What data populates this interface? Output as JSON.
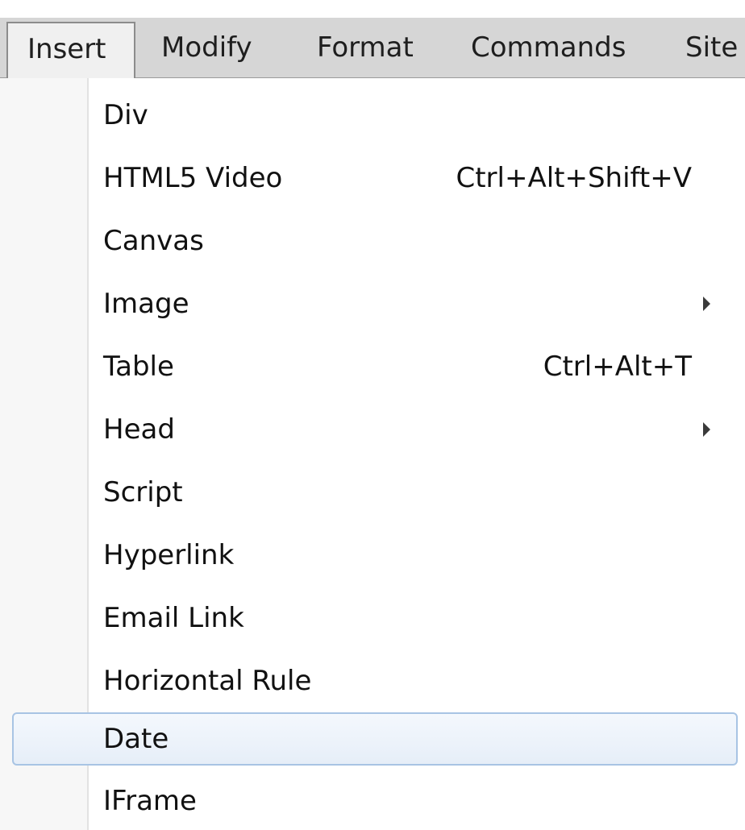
{
  "menubar": {
    "items": [
      {
        "label": "Insert",
        "active": true
      },
      {
        "label": "Modify",
        "active": false
      },
      {
        "label": "Format",
        "active": false
      },
      {
        "label": "Commands",
        "active": false
      },
      {
        "label": "Site",
        "active": false
      }
    ]
  },
  "dropdown": {
    "items": [
      {
        "label": "Div",
        "shortcut": "",
        "submenu": false
      },
      {
        "label": "HTML5 Video",
        "shortcut": "Ctrl+Alt+Shift+V",
        "submenu": false
      },
      {
        "label": "Canvas",
        "shortcut": "",
        "submenu": false
      },
      {
        "label": "Image",
        "shortcut": "",
        "submenu": true
      },
      {
        "label": "Table",
        "shortcut": "Ctrl+Alt+T",
        "submenu": false
      },
      {
        "label": "Head",
        "shortcut": "",
        "submenu": true
      },
      {
        "label": "Script",
        "shortcut": "",
        "submenu": false
      },
      {
        "label": "Hyperlink",
        "shortcut": "",
        "submenu": false
      },
      {
        "label": "Email Link",
        "shortcut": "",
        "submenu": false
      },
      {
        "label": "Horizontal Rule",
        "shortcut": "",
        "submenu": false
      },
      {
        "label": "Date",
        "shortcut": "",
        "submenu": false,
        "highlighted": true
      },
      {
        "label": "IFrame",
        "shortcut": "",
        "submenu": false
      }
    ]
  },
  "colors": {
    "menubar_bg": "#d6d6d6",
    "highlight_border": "#a8c4e4",
    "highlight_bg": "#e6eef8"
  }
}
